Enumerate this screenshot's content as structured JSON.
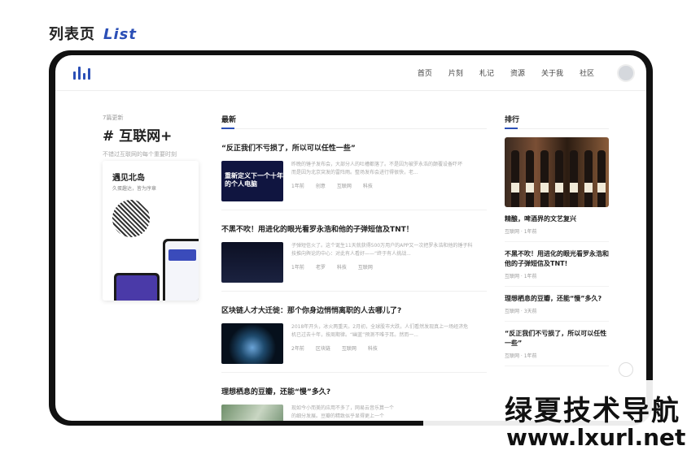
{
  "heading": {
    "zh": "列表页",
    "en": "List"
  },
  "nav": {
    "items": [
      "首页",
      "片刻",
      "札记",
      "资源",
      "关于我",
      "社区"
    ]
  },
  "sidebar": {
    "update_note": "7篇更新",
    "topic": "# 互联网+",
    "topic_desc": "不错过互联网的每个重要时刻",
    "qr_title": "遇见北岛",
    "qr_sub": "久蛋趣达，皆为序章"
  },
  "latest": {
    "title": "最新",
    "articles": [
      {
        "title": "“反正我们不亏损了，所以可以任性一些”",
        "thumb_text": "重新定义下一个十年的个人电脑",
        "excerpt1": "昨晚的锤子发布会，大部分人的吐槽都落了。不是因为被罗永浩的颠覆设备吓坏",
        "excerpt2": "而是因为北京突发的雷阵雨。整场发布会进行得很快，老...",
        "meta": [
          "1年前",
          "创意",
          "互联网",
          "科技"
        ]
      },
      {
        "title": "不黑不吹！用进化的眼光看罗永浩和他的子弹短信及TNT！",
        "excerpt1": "子弹短信火了。这个诞生11天就获得500万用户的APP又一次把罗永浩和他的锤子科",
        "excerpt2": "技推向舆论的中心：对此有人看好——“终于有人挑战...",
        "meta": [
          "1年前",
          "老罗",
          "科技",
          "互联网"
        ]
      },
      {
        "title": "区块链人才大迁徙：那个你身边悄悄离职的人去哪儿了?",
        "excerpt1": "2018年开头，冰火两重天。2月初，全球股市大跌，人们看然发现真上一场经济危",
        "excerpt2": "机已过去十年，按周期律。“幽蓝”预测不唯于耳。然而一...",
        "meta": [
          "2年前",
          "区块链",
          "互联网",
          "科技"
        ]
      },
      {
        "title": "理想栖息的豆瓣，还能“慢”多久?",
        "excerpt1": "现如今小而美的应用不多了，网易云音乐算一个",
        "excerpt2": "的细分发展。豆瓣的精致似乎显得更上一个",
        "meta": []
      }
    ]
  },
  "ranking": {
    "title": "排行",
    "items": [
      {
        "title": "精酿，啤酒界的文艺复兴",
        "meta": "互联网 · 1年前"
      },
      {
        "title": "不黑不吹！用进化的眼光看罗永浩和他的子弹短信及TNT!",
        "meta": "互联网 · 1年前"
      },
      {
        "title": "理想栖息的豆瓣，还能“慢”多久?",
        "meta": "互联网 · 3天前"
      },
      {
        "title": "“反正我们不亏损了，所以可以任性一些”",
        "meta": "互联网 · 1年前"
      }
    ]
  },
  "watermark": {
    "line1": "绿夏技术导航",
    "line2": "www.lxurl.net"
  }
}
